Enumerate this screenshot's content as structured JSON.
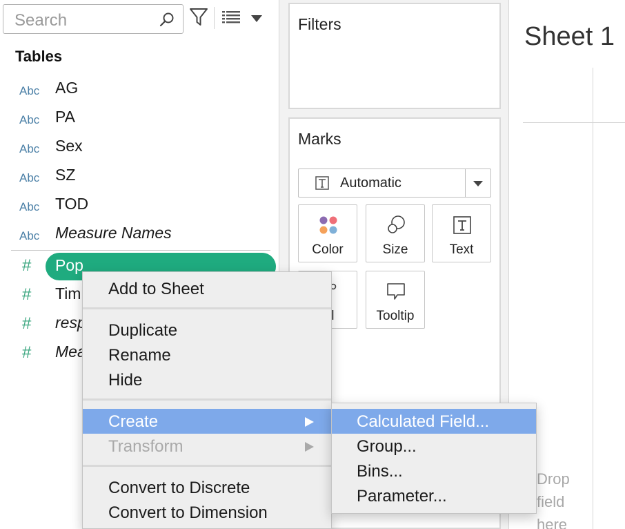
{
  "data_pane": {
    "search_placeholder": "Search",
    "tables_heading": "Tables",
    "dimensions": [
      {
        "type": "Abc",
        "name": "AG",
        "italic": false
      },
      {
        "type": "Abc",
        "name": "PA",
        "italic": false
      },
      {
        "type": "Abc",
        "name": "Sex",
        "italic": false
      },
      {
        "type": "Abc",
        "name": "SZ",
        "italic": false
      },
      {
        "type": "Abc",
        "name": "TOD",
        "italic": false
      },
      {
        "type": "Abc",
        "name": "Measure Names",
        "italic": true
      }
    ],
    "measures": [
      {
        "type": "#",
        "name": "Pop",
        "selected": true
      },
      {
        "type": "#",
        "name": "Tim"
      },
      {
        "type": "#",
        "name": "resp"
      },
      {
        "type": "#",
        "name": "Mea"
      }
    ],
    "icons": [
      "search-icon",
      "filter-icon",
      "list-view-icon",
      "chevron-down-icon"
    ]
  },
  "shelves": {
    "filters_title": "Filters",
    "marks_title": "Marks",
    "mark_type": "Automatic",
    "mark_buttons": [
      {
        "label": "Color",
        "icon": "color-icon"
      },
      {
        "label": "Size",
        "icon": "size-icon"
      },
      {
        "label": "Text",
        "icon": "text-icon"
      },
      {
        "label": "ail",
        "icon": "detail-icon"
      },
      {
        "label": "Tooltip",
        "icon": "tooltip-icon"
      }
    ]
  },
  "sheet": {
    "title": "Sheet 1",
    "drop_hint": [
      "Drop",
      "field",
      "here"
    ]
  },
  "context_menu": {
    "items": [
      {
        "label": "Add to Sheet"
      },
      {
        "label": "Duplicate"
      },
      {
        "label": "Rename"
      },
      {
        "label": "Hide"
      },
      {
        "label": "Create",
        "highlighted": true,
        "submenu": true
      },
      {
        "label": "Transform",
        "disabled": true,
        "submenu": true
      },
      {
        "label": "Convert to Discrete"
      },
      {
        "label": "Convert to Dimension"
      }
    ],
    "submenu": [
      {
        "label": "Calculated Field...",
        "highlighted": true
      },
      {
        "label": "Group..."
      },
      {
        "label": "Bins..."
      },
      {
        "label": "Parameter..."
      }
    ]
  },
  "colors": {
    "accent_green": "#1fab7f",
    "menu_highlight": "#7ea9ea",
    "dimension_blue": "#4a7fa6",
    "measure_green": "#3fa882"
  }
}
